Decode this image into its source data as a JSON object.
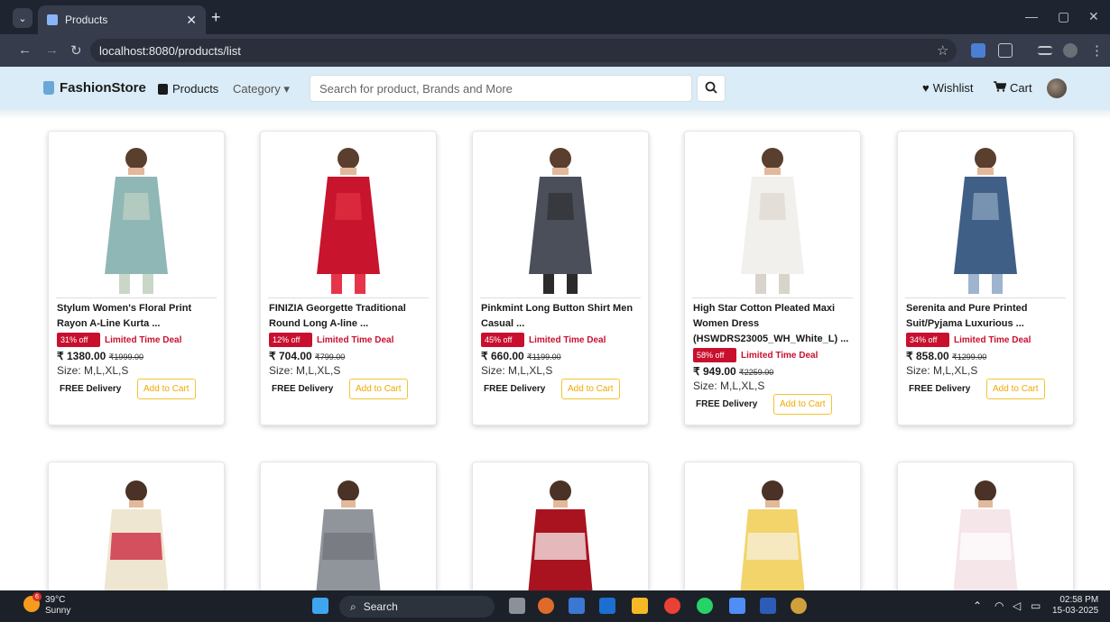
{
  "browser": {
    "tab_title": "Products",
    "url": "localhost:8080/products/list"
  },
  "navbar": {
    "brand": "FashionStore",
    "products_label": "Products",
    "category_label": "Category",
    "search_placeholder": "Search for product, Brands and More",
    "wishlist_label": "Wishlist",
    "cart_label": "Cart"
  },
  "products": [
    {
      "name_line1": "Stylum Women's Floral Print",
      "name_line2": "Rayon A-Line Kurta ...",
      "name_line3": "",
      "discount": "31% off",
      "deal": "Limited Time Deal",
      "price": "₹ 1380.00",
      "mrp": "₹1999.00",
      "sizes": "Size: M,L,XL,S",
      "delivery": "FREE Delivery",
      "add_to_cart": "Add to Cart",
      "color": "#8fb7b5",
      "accent": "#c9d7c8"
    },
    {
      "name_line1": "FINIZIA Georgette Traditional",
      "name_line2": "Round Long A-line ...",
      "name_line3": "",
      "discount": "12% off",
      "deal": "Limited Time Deal",
      "price": "₹ 704.00",
      "mrp": "₹799.00",
      "sizes": "Size: M,L,XL,S",
      "delivery": "FREE Delivery",
      "add_to_cart": "Add to Cart",
      "color": "#c8142c",
      "accent": "#e6354a"
    },
    {
      "name_line1": "Pinkmint Long Button Shirt Men",
      "name_line2": "Casual ...",
      "name_line3": "",
      "discount": "45% off",
      "deal": "Limited Time Deal",
      "price": "₹ 660.00",
      "mrp": "₹1199.00",
      "sizes": "Size: M,L,XL,S",
      "delivery": "FREE Delivery",
      "add_to_cart": "Add to Cart",
      "color": "#4a4f5a",
      "accent": "#2b2b2b"
    },
    {
      "name_line1": "High Star Cotton Pleated Maxi",
      "name_line2": "Women Dress",
      "name_line3": "(HSWDRS23005_WH_White_L) ...",
      "discount": "58% off",
      "deal": "Limited Time Deal",
      "price": "₹ 949.00",
      "mrp": "₹2259.00",
      "sizes": "Size: M,L,XL,S",
      "delivery": "FREE Delivery",
      "add_to_cart": "Add to Cart",
      "color": "#f2f0ec",
      "accent": "#d8d4cc"
    },
    {
      "name_line1": "Serenita and Pure Printed",
      "name_line2": "Suit/Pyjama Luxurious ...",
      "name_line3": "",
      "discount": "34% off",
      "deal": "Limited Time Deal",
      "price": "₹ 858.00",
      "mrp": "₹1299.00",
      "sizes": "Size: M,L,XL,S",
      "delivery": "FREE Delivery",
      "add_to_cart": "Add to Cart",
      "color": "#3f5f86",
      "accent": "#9fb4cf"
    }
  ],
  "products_row2": [
    {
      "color": "#efe6d2",
      "accent": "#c8102e"
    },
    {
      "color": "#8f959a",
      "accent": "#6f7479"
    },
    {
      "color": "#a8131f",
      "accent": "#ffffff"
    },
    {
      "color": "#f3d46a",
      "accent": "#f6f2e4"
    },
    {
      "color": "#f5e6ea",
      "accent": "#ffffff"
    }
  ],
  "taskbar": {
    "temp": "39°C",
    "weather": "Sunny",
    "weather_badge": "6",
    "search_label": "Search",
    "time": "02:58 PM",
    "date": "15-03-2025"
  }
}
